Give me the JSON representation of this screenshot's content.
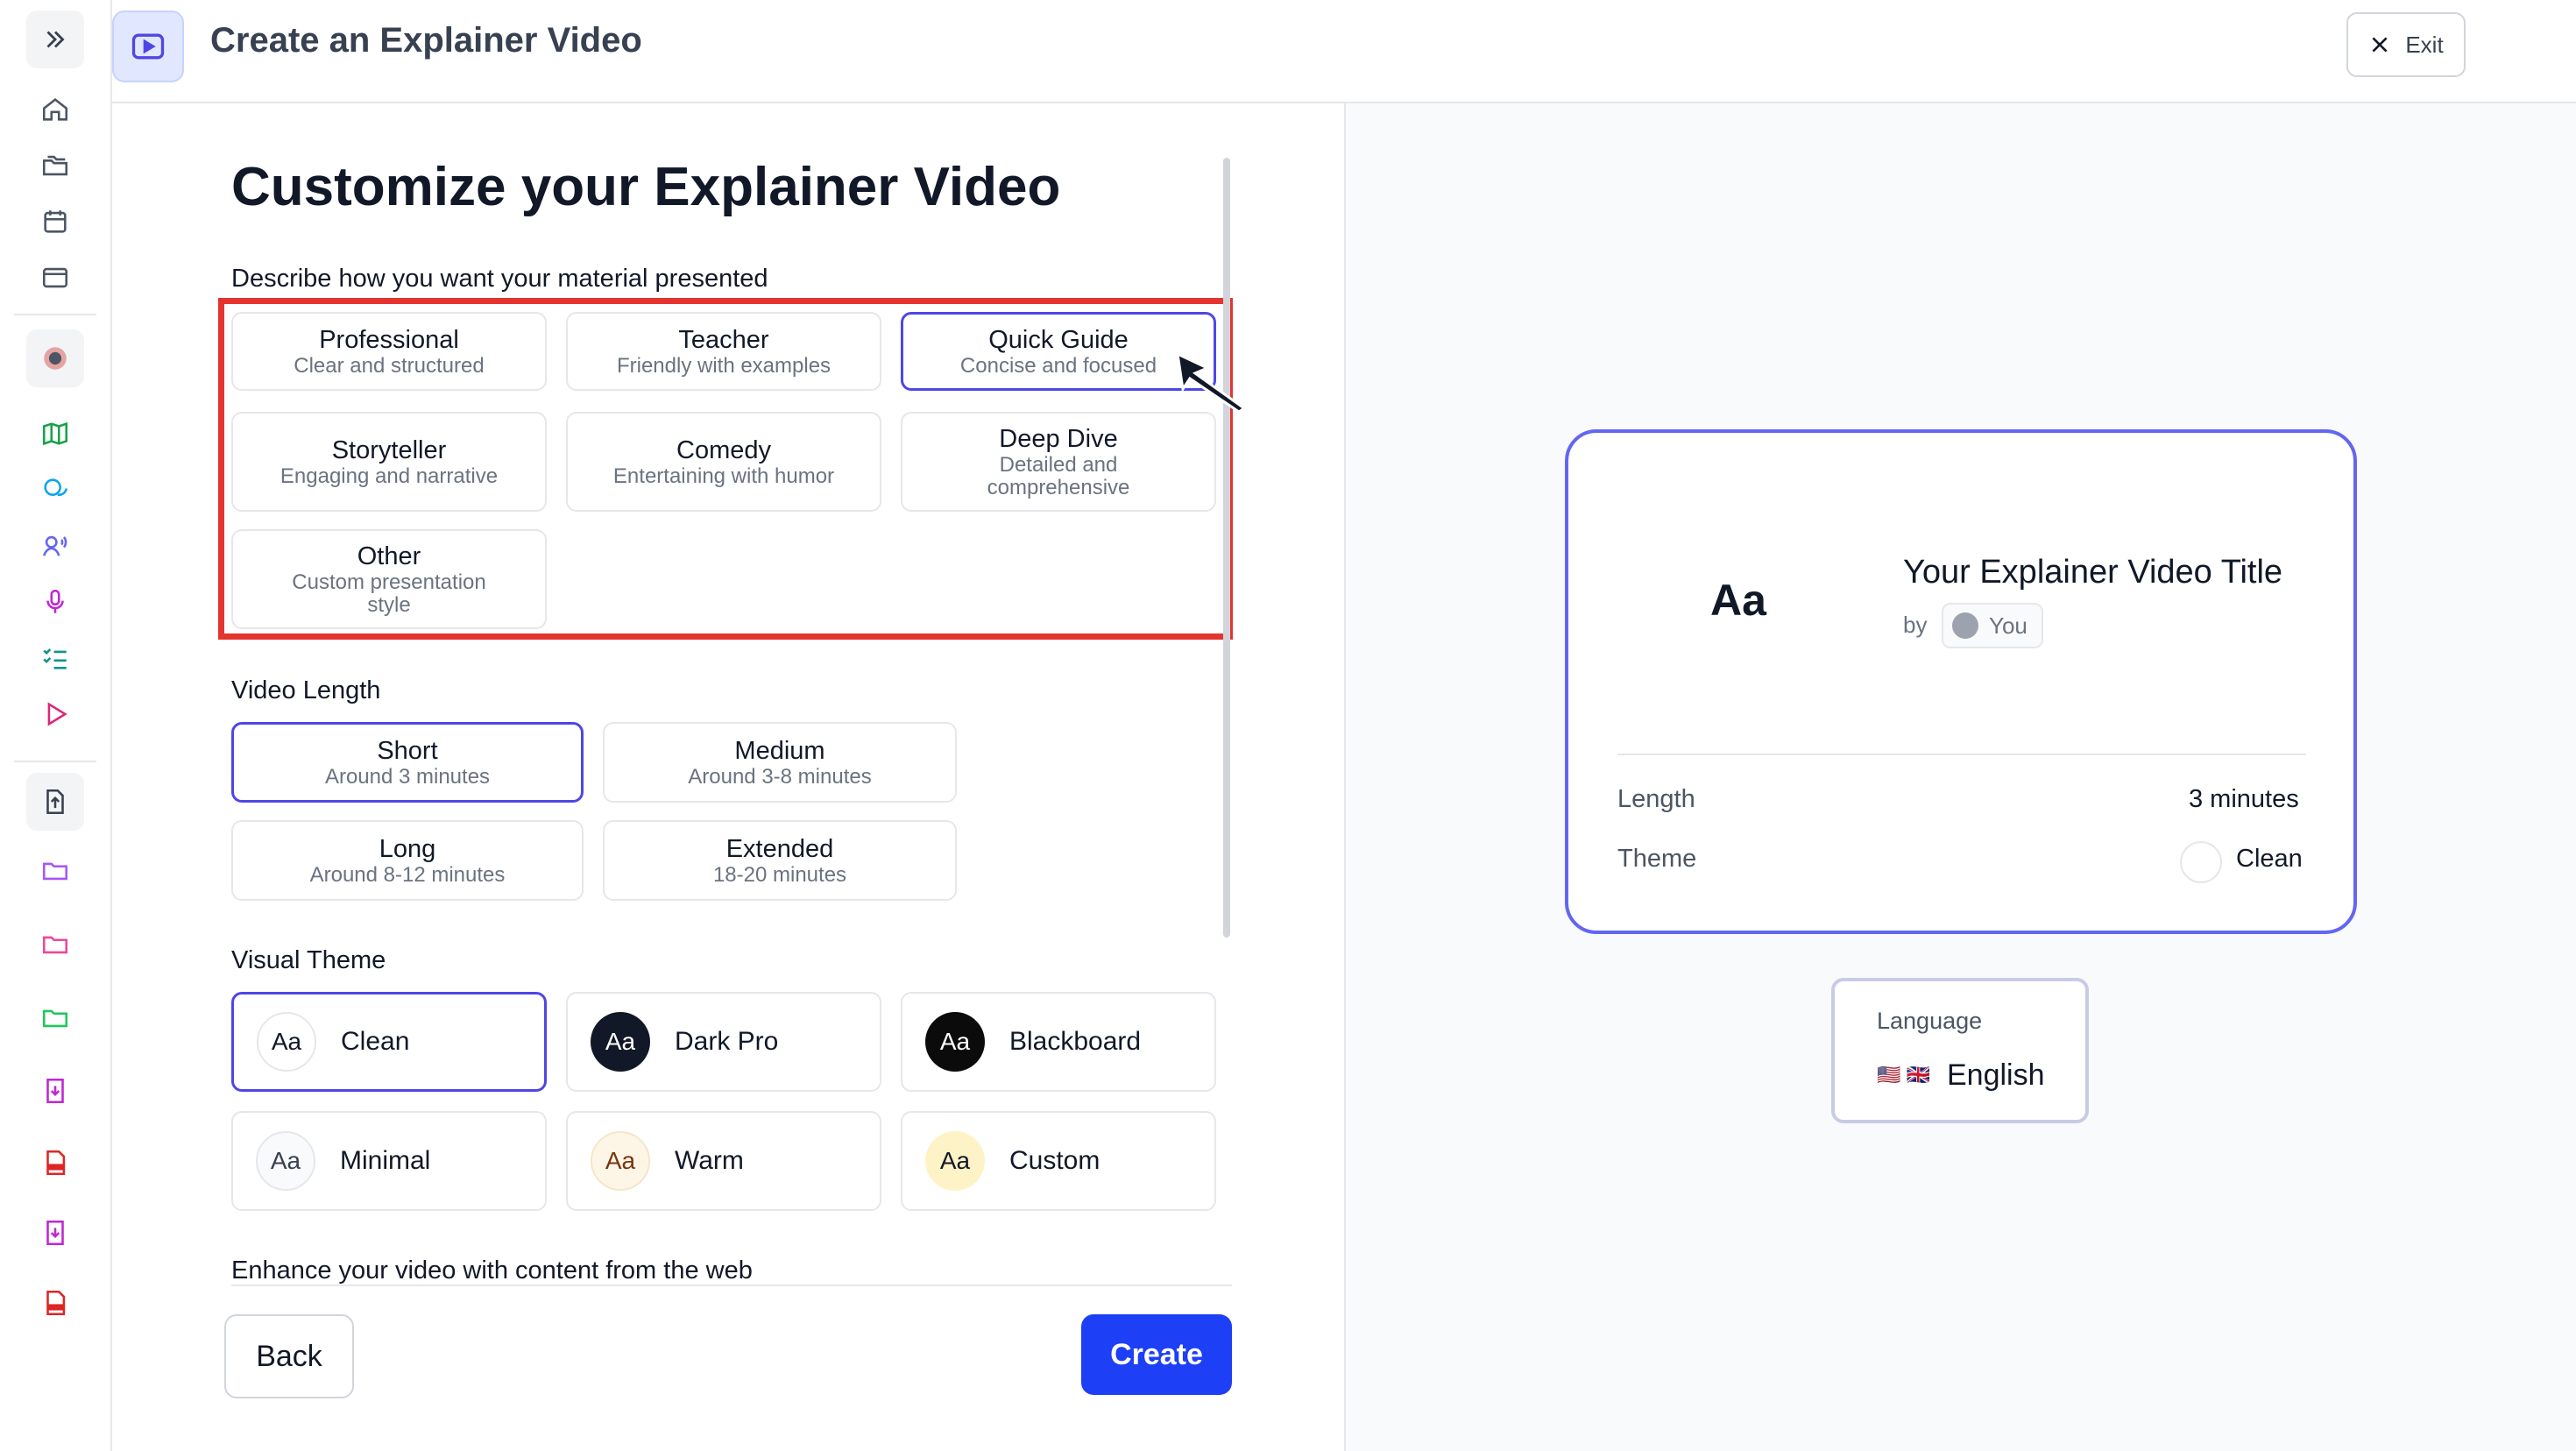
{
  "header": {
    "title": "Create an Explainer Video",
    "exit_label": "Exit"
  },
  "page": {
    "heading": "Customize your Explainer Video"
  },
  "presentation": {
    "label": "Describe how you want your material presented",
    "options": [
      {
        "title": "Professional",
        "subtitle": "Clear and structured"
      },
      {
        "title": "Teacher",
        "subtitle": "Friendly with examples"
      },
      {
        "title": "Quick Guide",
        "subtitle": "Concise and focused",
        "selected": true
      },
      {
        "title": "Storyteller",
        "subtitle": "Engaging and narrative"
      },
      {
        "title": "Comedy",
        "subtitle": "Entertaining with humor"
      },
      {
        "title": "Deep Dive",
        "subtitle": "Detailed and comprehensive"
      },
      {
        "title": "Other",
        "subtitle": "Custom presentation style"
      }
    ]
  },
  "video_length": {
    "label": "Video Length",
    "options": [
      {
        "title": "Short",
        "subtitle": "Around 3 minutes",
        "selected": true
      },
      {
        "title": "Medium",
        "subtitle": "Around 3-8 minutes"
      },
      {
        "title": "Long",
        "subtitle": "Around 8-12 minutes"
      },
      {
        "title": "Extended",
        "subtitle": "18-20 minutes"
      }
    ]
  },
  "visual_theme": {
    "label": "Visual Theme",
    "options": [
      {
        "swatch": "Aa",
        "name": "Clean",
        "selected": true
      },
      {
        "swatch": "Aa",
        "name": "Dark Pro"
      },
      {
        "swatch": "Aa",
        "name": "Blackboard"
      },
      {
        "swatch": "Aa",
        "name": "Minimal"
      },
      {
        "swatch": "Aa",
        "name": "Warm"
      },
      {
        "swatch": "Aa",
        "name": "Custom"
      }
    ]
  },
  "web_enhance": {
    "label": "Enhance your video with content from the web"
  },
  "actions": {
    "back_label": "Back",
    "create_label": "Create"
  },
  "preview": {
    "aa": "Aa",
    "title": "Your Explainer Video Title",
    "by": "by",
    "author": "You",
    "length_label": "Length",
    "length_value": "3 minutes",
    "theme_label": "Theme",
    "theme_value": "Clean"
  },
  "language": {
    "label": "Language",
    "flags": "🇺🇸 🇬🇧",
    "value": "English"
  },
  "colors": {
    "accent": "#4f46e5",
    "primary_button": "#1d3ff5",
    "highlight": "#e3342f"
  }
}
